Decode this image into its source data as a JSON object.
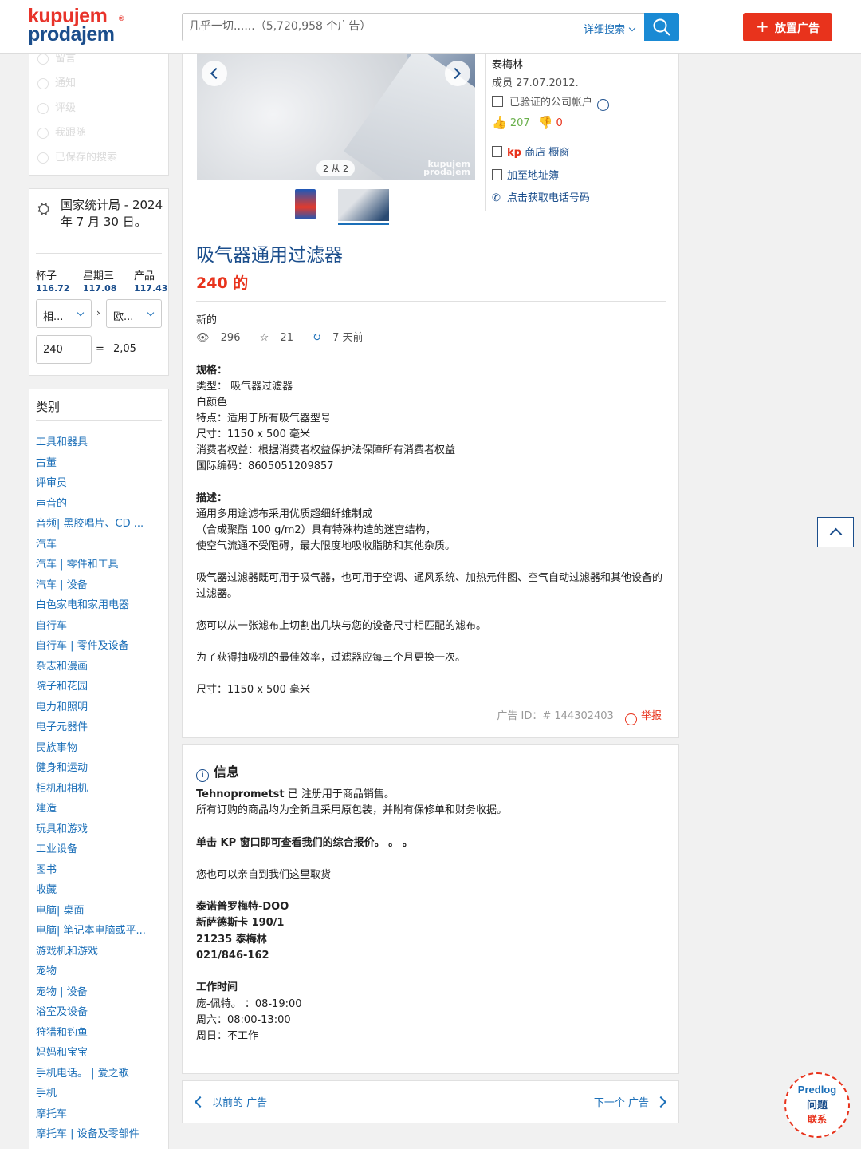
{
  "header": {
    "logo_line1": "kupujem",
    "logo_line2": "prodajem",
    "logo_reg": "®",
    "search_placeholder": "几乎一切......（5,720,958 个广告）",
    "advanced_search": "详细搜索",
    "post_ad": "放置广告"
  },
  "sidebar_menu": [
    "留言",
    "通知",
    "评级",
    "我跟随",
    "已保存的搜索"
  ],
  "exchange": {
    "title": "国家统计局 - 2024 年 7 月 30 日。",
    "cols": [
      {
        "label": "杯子",
        "value": "116.72"
      },
      {
        "label": "星期三",
        "value": "117.08"
      },
      {
        "label": "产品",
        "value": "117.43"
      }
    ],
    "from_currency": "相...",
    "to_currency": "欧...",
    "amount": "240",
    "equals": "=",
    "result": "2,05"
  },
  "categories": {
    "title": "类别",
    "items": [
      "工具和器具",
      "古董",
      "评审员",
      "声音的",
      "音频| 黑胶唱片、CD ...",
      "汽车",
      "汽车 | 零件和工具",
      "汽车 | 设备",
      "白色家电和家用电器",
      "自行车",
      "自行车 | 零件及设备",
      "杂志和漫画",
      "院子和花园",
      "电力和照明",
      "电子元器件",
      "民族事物",
      "健身和运动",
      "相机和相机",
      "建造",
      "玩具和游戏",
      "工业设备",
      "图书",
      "收藏",
      "电脑| 桌面",
      "电脑| 笔记本电脑或平...",
      "游戏机和游戏",
      "宠物",
      "宠物 | 设备",
      "浴室及设备",
      "狩猎和钓鱼",
      "妈妈和宝宝",
      "手机电话。 | 爱之歌",
      "手机",
      "摩托车",
      "摩托车 | 设备及零部件"
    ]
  },
  "gallery": {
    "counter": "2 从 2",
    "watermark1": "kupujem",
    "watermark2": "prodajem"
  },
  "seller": {
    "name": "泰梅林",
    "member_since": "成员 27.07.2012.",
    "verified": "已验证的公司帐户",
    "likes": "207",
    "dislikes": "0",
    "shop_kp": "kp",
    "shop_label": "商店 橱窗",
    "address_book": "加至地址簿",
    "phone": "点击获取电话号码"
  },
  "ad": {
    "title": "吸气器通用过滤器",
    "price": "240 的",
    "condition": "新的",
    "views": "296",
    "favorites": "21",
    "age": "7 天前",
    "description": [
      "规格：",
      "类型： 吸气器过滤器",
      "白颜色",
      "特点：适用于所有吸气器型号",
      "尺寸：1150 x 500 毫米",
      "消费者权益：根据消费者权益保护法保障所有消费者权益",
      "国际编码：8605051209857",
      "",
      "描述：",
      "通用多用途滤布采用优质超细纤维制成",
      "（合成聚酯 100 g/m2）具有特殊构造的迷宫结构，",
      "使空气流通不受阻碍，最大限度地吸收脂肪和其他杂质。",
      "",
      "吸气器过滤器既可用于吸气器，也可用于空调、通风系统、加热元件图、空气自动过滤器和其他设备的过滤器。",
      "",
      "您可以从一张滤布上切割出几块与您的设备尺寸相匹配的滤布。",
      "",
      "为了获得抽吸机的最佳效率，过滤器应每三个月更换一次。",
      "",
      "尺寸：1150 x 500 毫米"
    ],
    "ad_id": "广告 ID：# 144302403",
    "report": "举报"
  },
  "info": {
    "title": "信息",
    "company": "Tehnoprometst",
    "line1_rest": " 已 注册用于商品销售。",
    "line2": "所有订购的商品均为全新且采用原包装，并附有保修单和财务收据。",
    "line3": "单击 KP 窗口即可查看我们的综合报价。 。 。",
    "line4": "您也可以亲自到我们这里取货",
    "addr1": "泰诺普罗梅特-DOO",
    "addr2": "新萨德斯卡 190/1",
    "addr3": "21235 泰梅林",
    "addr4": "021/846-162",
    "hours_title": "工作时间",
    "hours1": "庞-佩特。 ：08-19:00",
    "hours2": "周六：08:00-13:00",
    "hours3": "周日：不工作"
  },
  "nav": {
    "prev": "以前的 广告",
    "next": "下一个 广告"
  },
  "feedback": {
    "line1": "Predlog",
    "line2": "问题",
    "line3": "联系"
  }
}
